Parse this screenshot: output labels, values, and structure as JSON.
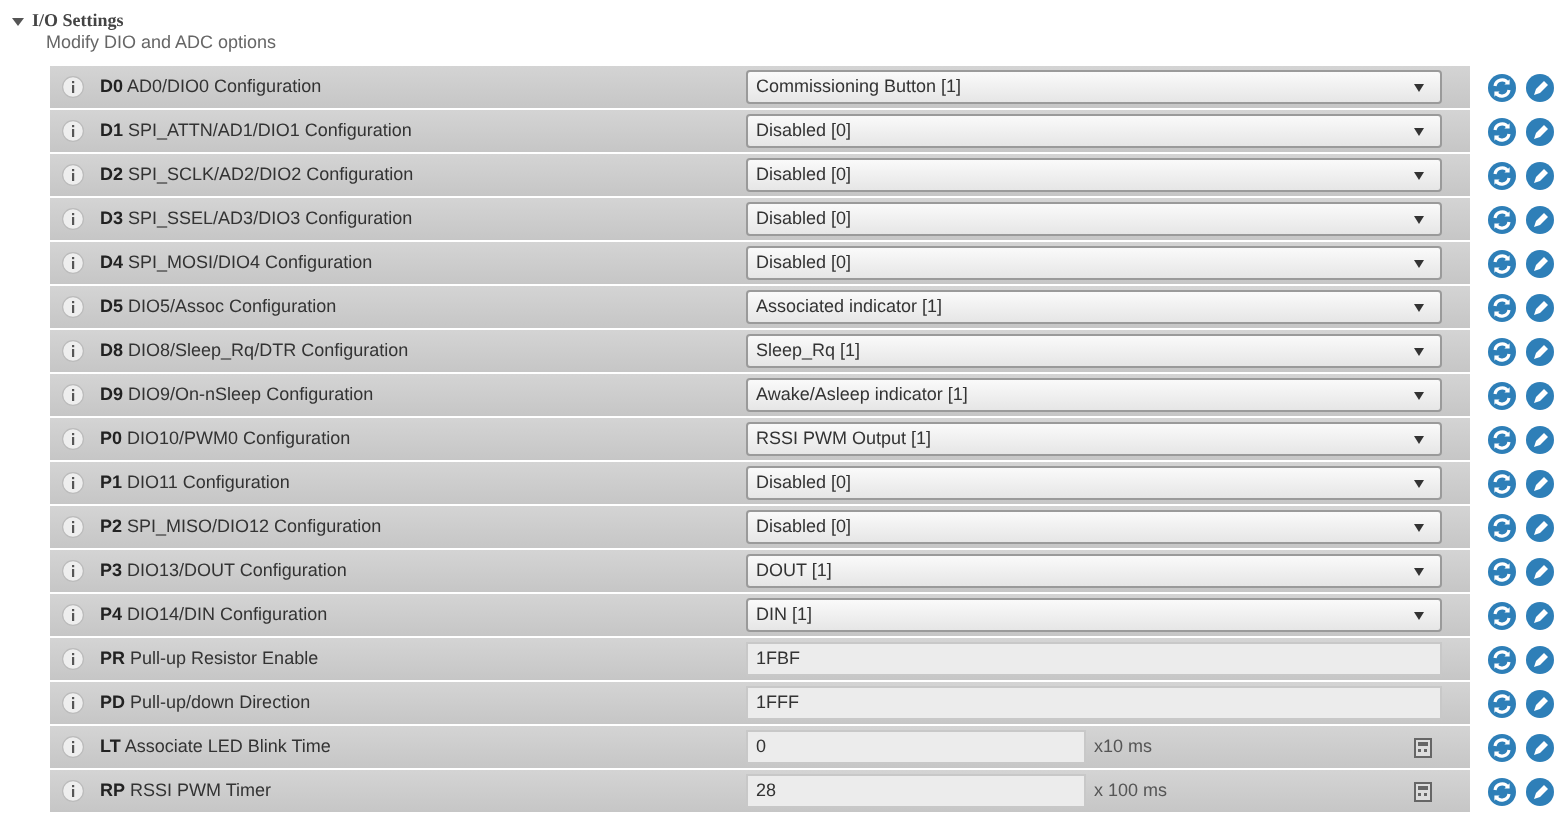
{
  "section": {
    "title": "I/O Settings",
    "subtitle": "Modify DIO and ADC options",
    "expanded": true
  },
  "rows": [
    {
      "kind": "select",
      "code": "D0",
      "label": "AD0/DIO0 Configuration",
      "value": "Commissioning Button [1]"
    },
    {
      "kind": "select",
      "code": "D1",
      "label": "SPI_ATTN/AD1/DIO1 Configuration",
      "value": "Disabled [0]"
    },
    {
      "kind": "select",
      "code": "D2",
      "label": "SPI_SCLK/AD2/DIO2 Configuration",
      "value": "Disabled [0]"
    },
    {
      "kind": "select",
      "code": "D3",
      "label": "SPI_SSEL/AD3/DIO3 Configuration",
      "value": "Disabled [0]"
    },
    {
      "kind": "select",
      "code": "D4",
      "label": "SPI_MOSI/DIO4 Configuration",
      "value": "Disabled [0]"
    },
    {
      "kind": "select",
      "code": "D5",
      "label": "DIO5/Assoc Configuration",
      "value": "Associated indicator [1]"
    },
    {
      "kind": "select",
      "code": "D8",
      "label": "DIO8/Sleep_Rq/DTR Configuration",
      "value": "Sleep_Rq [1]"
    },
    {
      "kind": "select",
      "code": "D9",
      "label": "DIO9/On-nSleep Configuration",
      "value": "Awake/Asleep indicator [1]"
    },
    {
      "kind": "select",
      "code": "P0",
      "label": "DIO10/PWM0 Configuration",
      "value": "RSSI PWM Output [1]"
    },
    {
      "kind": "select",
      "code": "P1",
      "label": "DIO11 Configuration",
      "value": "Disabled [0]"
    },
    {
      "kind": "select",
      "code": "P2",
      "label": "SPI_MISO/DIO12 Configuration",
      "value": "Disabled [0]"
    },
    {
      "kind": "select",
      "code": "P3",
      "label": "DIO13/DOUT Configuration",
      "value": "DOUT [1]"
    },
    {
      "kind": "select",
      "code": "P4",
      "label": "DIO14/DIN Configuration",
      "value": "DIN [1]"
    },
    {
      "kind": "text",
      "code": "PR",
      "label": "Pull-up Resistor Enable",
      "value": "1FBF"
    },
    {
      "kind": "text",
      "code": "PD",
      "label": "Pull-up/down Direction",
      "value": "1FFF"
    },
    {
      "kind": "number",
      "code": "LT",
      "label": "Associate LED Blink Time",
      "value": "0",
      "unit": "x10 ms"
    },
    {
      "kind": "number",
      "code": "RP",
      "label": "RSSI PWM Timer",
      "value": "28",
      "unit": "x 100 ms"
    }
  ]
}
